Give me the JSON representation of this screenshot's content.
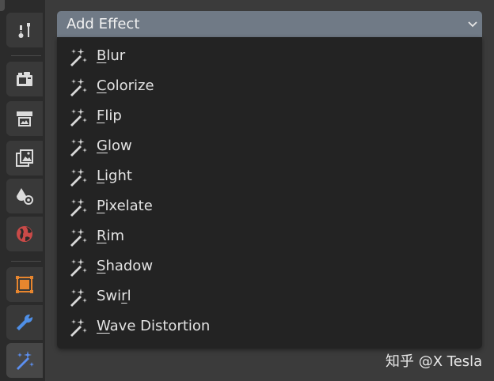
{
  "header": {
    "title": "Add Effect"
  },
  "menu": {
    "items": [
      {
        "mnemonic": "B",
        "rest": "lur"
      },
      {
        "mnemonic": "C",
        "rest": "olorize"
      },
      {
        "mnemonic": "F",
        "rest": "lip"
      },
      {
        "mnemonic": "G",
        "rest": "low"
      },
      {
        "mnemonic": "L",
        "rest": "ight"
      },
      {
        "mnemonic": "P",
        "rest": "ixelate"
      },
      {
        "mnemonic": "R",
        "rest": "im"
      },
      {
        "mnemonic": "S",
        "rest": "hadow"
      },
      {
        "pre": "Swi",
        "mnemonic": "r",
        "rest": "l"
      },
      {
        "mnemonic": "W",
        "rest": "ave Distortion"
      }
    ],
    "item_icon": "magic-wand-sparkle-icon"
  },
  "sidebar": {
    "tabs": [
      {
        "icon": "tool-icon"
      },
      {
        "icon": "render-camera-icon"
      },
      {
        "icon": "output-printer-icon"
      },
      {
        "icon": "view-layer-images-icon"
      },
      {
        "icon": "scene-icon"
      },
      {
        "icon": "world-icon"
      },
      {
        "icon": "object-icon"
      },
      {
        "icon": "modifier-wrench-icon"
      },
      {
        "icon": "shader-fx-icon",
        "active": true
      }
    ]
  },
  "watermark": {
    "text": "知乎 @X Tesla"
  },
  "colors": {
    "header_bg": "#707a86",
    "menu_bg": "#232323",
    "object_orange": "#e8862e",
    "world_red": "#c94a48",
    "wrench_blue": "#4f8fe6",
    "fx_blue": "#5c8ff0"
  }
}
